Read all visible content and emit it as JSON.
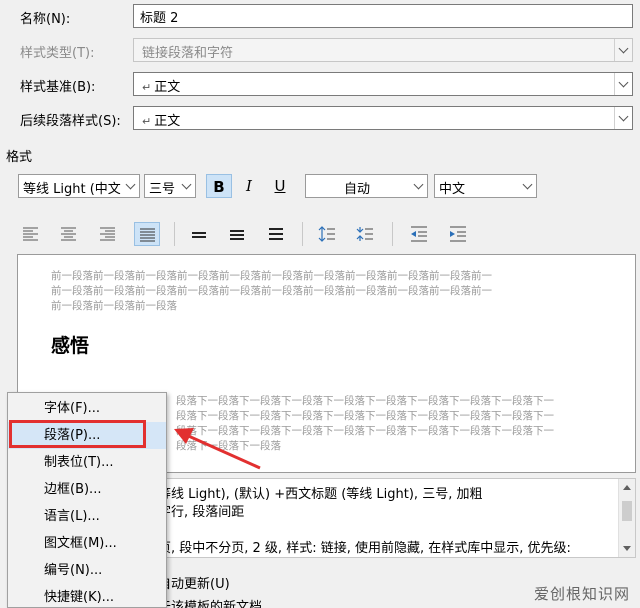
{
  "fields": {
    "name": {
      "label": "名称(N):",
      "value": "标题 2"
    },
    "style_type": {
      "label": "样式类型(T):",
      "value": "链接段落和字符"
    },
    "based_on": {
      "label": "样式基准(B):",
      "value": "正文"
    },
    "following": {
      "label": "后续段落样式(S):",
      "value": "正文"
    }
  },
  "format": {
    "section_label": "格式",
    "font": "等线 Light (中文",
    "size": "三号",
    "bold": "B",
    "italic": "I",
    "underline": "U",
    "color": "自动",
    "script": "中文"
  },
  "preview": {
    "prev_lines": [
      "前一段落前一段落前一段落前一段落前一段落前一段落前一段落前一段落前一段落前一段落前一",
      "前一段落前一段落前一段落前一段落前一段落前一段落前一段落前一段落前一段落前一段落前一",
      "前一段落前一段落前一段落"
    ],
    "title": "感悟",
    "next_lines": [
      "段落下一段落下一段落下一段落下一段落下一段落下一段落下一段落下一段落下一",
      "段落下一段落下一段落下一段落下一段落下一段落下一段落下一段落下一段落下一",
      "段落下一段落下一段落下一段落下一段落下一段落下一段落下一段落下一段落下一",
      "段落下一段落下一段落"
    ]
  },
  "description": {
    "lines": [
      "等线 Light), (默认) +西文标题 (等线 Light), 三号, 加粗",
      "字行, 段落间距",
      "页, 段中不分页, 2 级, 样式: 链接, 使用前隐藏, 在样式库中显示, 优先级:"
    ]
  },
  "auto_update_label": "自动更新(U)",
  "partial_label": "于该模板的新文档",
  "context_menu": {
    "items": [
      {
        "label": "字体(F)..."
      },
      {
        "label": "段落(P)..."
      },
      {
        "label": "制表位(T)..."
      },
      {
        "label": "边框(B)..."
      },
      {
        "label": "语言(L)..."
      },
      {
        "label": "图文框(M)..."
      },
      {
        "label": "编号(N)..."
      },
      {
        "label": "快捷键(K)..."
      }
    ],
    "highlighted_index": 1
  },
  "watermark": "爱创根知识网",
  "colors": {
    "highlight": "#d5e6f7",
    "annotation": "#e23030",
    "toggle_on": "#cde3f7"
  }
}
